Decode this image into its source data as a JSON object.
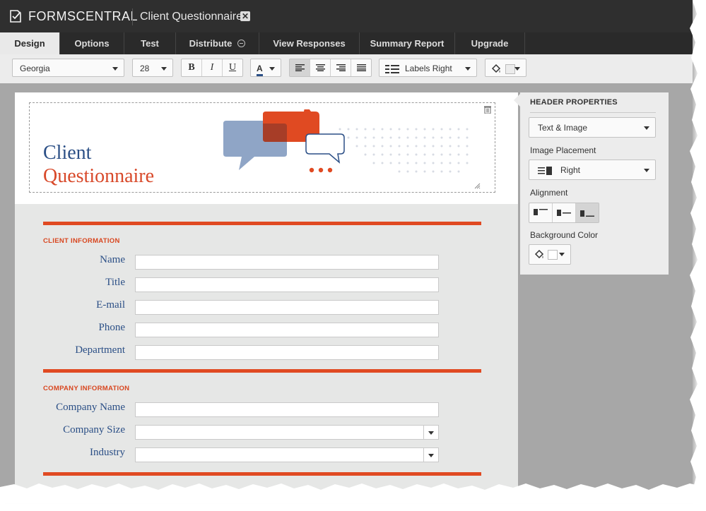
{
  "app": {
    "name": "FORMSCENTRAL",
    "document_title": "Client Questionnaire"
  },
  "tabs": [
    {
      "label": "Design",
      "active": true
    },
    {
      "label": "Options"
    },
    {
      "label": "Test"
    },
    {
      "label": "Distribute"
    },
    {
      "label": "View Responses"
    },
    {
      "label": "Summary Report"
    },
    {
      "label": "Upgrade"
    }
  ],
  "toolbar": {
    "font_family": "Georgia",
    "font_size": "28",
    "bold": "B",
    "italic": "I",
    "underline": "U",
    "text_color_letter": "A",
    "label_position": "Labels Right"
  },
  "header": {
    "title_line1": "Client",
    "title_line2": "Questionnaire",
    "hero_icon": "chat-bubbles-graphic",
    "hero_arrows": ">>>"
  },
  "sections": [
    {
      "label": "CLIENT INFORMATION",
      "fields": [
        {
          "label": "Name",
          "type": "text"
        },
        {
          "label": "Title",
          "type": "text"
        },
        {
          "label": "E-mail",
          "type": "text"
        },
        {
          "label": "Phone",
          "type": "text"
        },
        {
          "label": "Department",
          "type": "text"
        }
      ]
    },
    {
      "label": "COMPANY INFORMATION",
      "fields": [
        {
          "label": "Company Name",
          "type": "text"
        },
        {
          "label": "Company Size",
          "type": "select"
        },
        {
          "label": "Industry",
          "type": "select"
        }
      ]
    }
  ],
  "properties": {
    "title": "HEADER PROPERTIES",
    "header_type": "Text & Image",
    "image_placement_label": "Image Placement",
    "image_placement_value": "Right",
    "alignment_label": "Alignment",
    "background_color_label": "Background Color"
  },
  "colors": {
    "accent": "#e04a22",
    "label_blue": "#2b4f86",
    "bubble_blue": "#8fa5c6",
    "titlebar": "#2f2f2f"
  }
}
